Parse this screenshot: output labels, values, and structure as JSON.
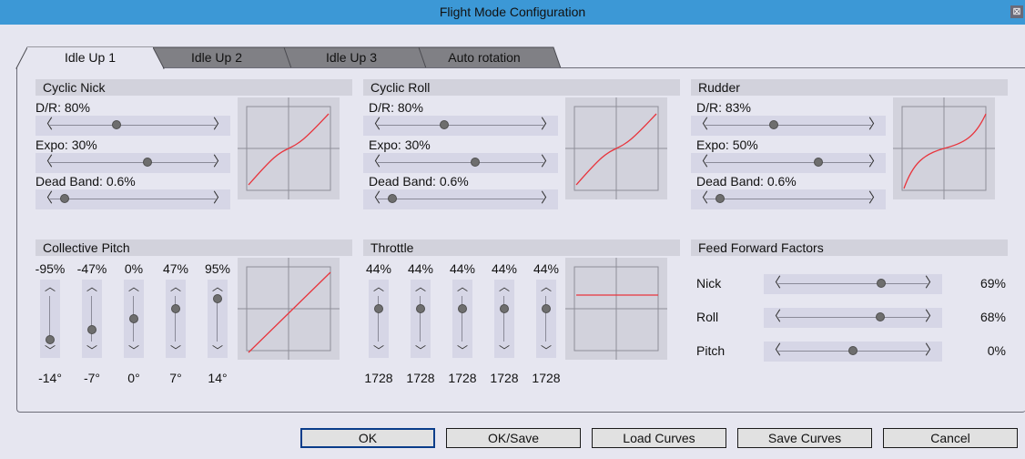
{
  "window": {
    "title": "Flight Mode Configuration",
    "close_glyph": "⊠"
  },
  "tabs": [
    {
      "label": "Idle Up 1",
      "active": true
    },
    {
      "label": "Idle Up 2",
      "active": false
    },
    {
      "label": "Idle Up 3",
      "active": false
    },
    {
      "label": "Auto rotation",
      "active": false
    }
  ],
  "cyclic_nick": {
    "title": "Cyclic Nick",
    "dr_label": "D/R: 80%",
    "dr_level": 0.4,
    "expo_label": "Expo: 30%",
    "expo_level": 0.59,
    "deadband_label": "Dead Band: 0.6%",
    "deadband_level": 0.09
  },
  "cyclic_roll": {
    "title": "Cyclic Roll",
    "dr_label": "D/R: 80%",
    "dr_level": 0.4,
    "expo_label": "Expo: 30%",
    "expo_level": 0.59,
    "deadband_label": "Dead Band: 0.6%",
    "deadband_level": 0.09
  },
  "rudder": {
    "title": "Rudder",
    "dr_label": "D/R: 83%",
    "dr_level": 0.41,
    "expo_label": "Expo: 50%",
    "expo_level": 0.68,
    "deadband_label": "Dead Band: 0.6%",
    "deadband_level": 0.09
  },
  "collective": {
    "title": "Collective Pitch",
    "points": [
      {
        "top": "-95%",
        "bottom": "-14°",
        "level": 0.05
      },
      {
        "top": "-47%",
        "bottom": "-7°",
        "level": 0.27
      },
      {
        "top": "0%",
        "bottom": "0°",
        "level": 0.5
      },
      {
        "top": "47%",
        "bottom": "7°",
        "level": 0.73
      },
      {
        "top": "95%",
        "bottom": "14°",
        "level": 0.95
      }
    ]
  },
  "throttle": {
    "title": "Throttle",
    "points": [
      {
        "top": "44%",
        "bottom": "1728",
        "level": 0.72
      },
      {
        "top": "44%",
        "bottom": "1728",
        "level": 0.72
      },
      {
        "top": "44%",
        "bottom": "1728",
        "level": 0.72
      },
      {
        "top": "44%",
        "bottom": "1728",
        "level": 0.72
      },
      {
        "top": "44%",
        "bottom": "1728",
        "level": 0.72
      }
    ]
  },
  "feed_forward": {
    "title": "Feed Forward Factors",
    "rows": [
      {
        "label": "Nick",
        "value": "69%",
        "level": 0.69
      },
      {
        "label": "Roll",
        "value": "68%",
        "level": 0.68
      },
      {
        "label": "Pitch",
        "value": "0%",
        "level": 0.5
      }
    ]
  },
  "icons": {
    "left": "〈",
    "right": "〉",
    "up": "︿",
    "down": "﹀"
  },
  "buttons": {
    "ok": "OK",
    "ok_save": "OK/Save",
    "load": "Load Curves",
    "save": "Save Curves",
    "cancel": "Cancel"
  },
  "colors": {
    "titlebar": "#3c98d6",
    "curve": "#e8343c",
    "panel": "#e6e6f0"
  }
}
